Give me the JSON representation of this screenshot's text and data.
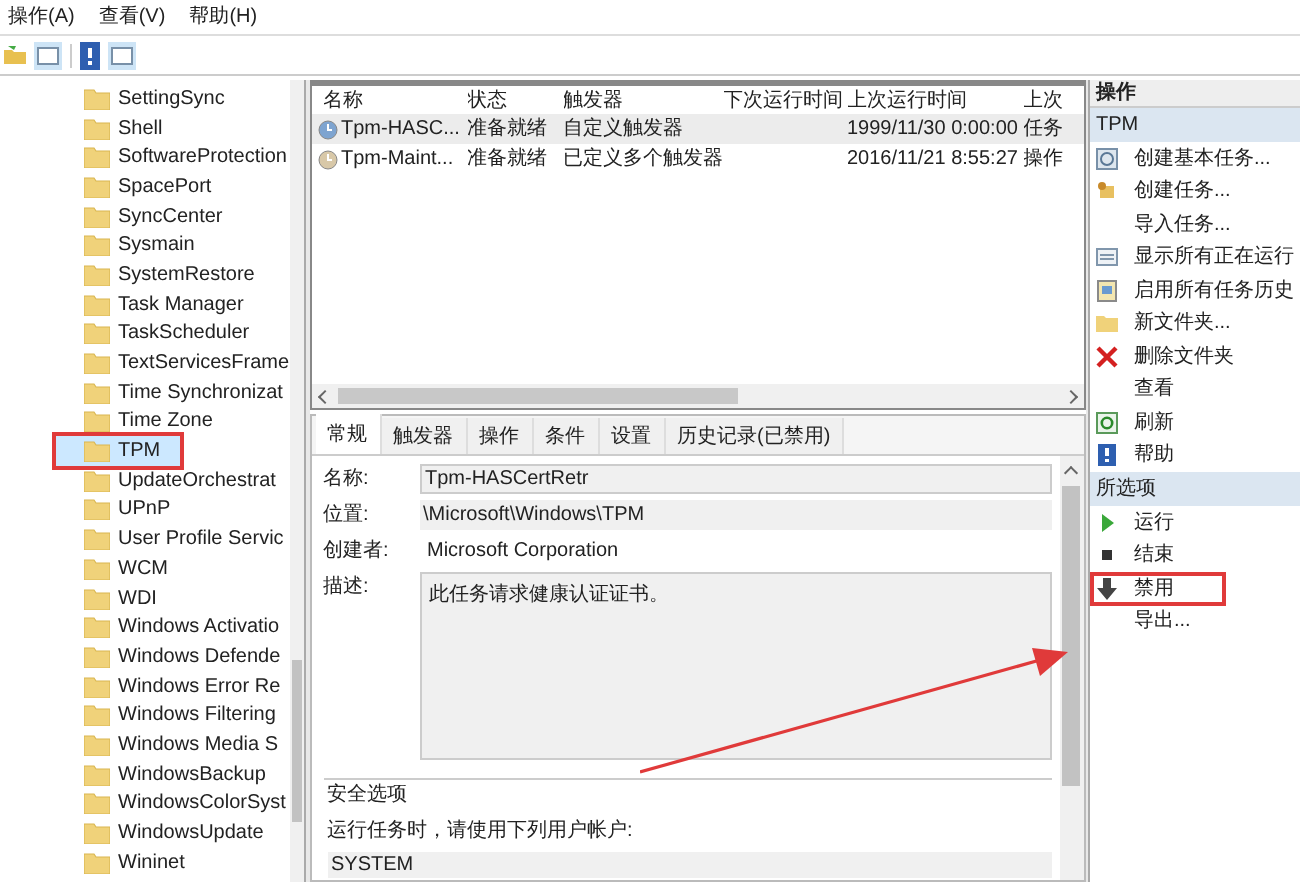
{
  "menu": [
    "操作(A)",
    "查看(V)",
    "帮助(H)"
  ],
  "tree": [
    {
      "label": "SettingSync",
      "selected": false,
      "highlighted": false
    },
    {
      "label": "Shell",
      "selected": false,
      "highlighted": false
    },
    {
      "label": "SoftwareProtection",
      "selected": false,
      "highlighted": false
    },
    {
      "label": "SpacePort",
      "selected": false,
      "highlighted": false
    },
    {
      "label": "SyncCenter",
      "selected": false,
      "highlighted": false
    },
    {
      "label": "Sysmain",
      "selected": false,
      "highlighted": false
    },
    {
      "label": "SystemRestore",
      "selected": false,
      "highlighted": false
    },
    {
      "label": "Task Manager",
      "selected": false,
      "highlighted": false
    },
    {
      "label": "TaskScheduler",
      "selected": false,
      "highlighted": false
    },
    {
      "label": "TextServicesFrame",
      "selected": false,
      "highlighted": false
    },
    {
      "label": "Time Synchronizat",
      "selected": false,
      "highlighted": false
    },
    {
      "label": "Time Zone",
      "selected": false,
      "highlighted": false
    },
    {
      "label": "TPM",
      "selected": true,
      "highlighted": true
    },
    {
      "label": "UpdateOrchestrat",
      "selected": false,
      "highlighted": false
    },
    {
      "label": "UPnP",
      "selected": false,
      "highlighted": false
    },
    {
      "label": "User Profile Servic",
      "selected": false,
      "highlighted": false
    },
    {
      "label": "WCM",
      "selected": false,
      "highlighted": false
    },
    {
      "label": "WDI",
      "selected": false,
      "highlighted": false
    },
    {
      "label": "Windows Activatio",
      "selected": false,
      "highlighted": false
    },
    {
      "label": "Windows Defende",
      "selected": false,
      "highlighted": false
    },
    {
      "label": "Windows Error Re",
      "selected": false,
      "highlighted": false
    },
    {
      "label": "Windows Filtering",
      "selected": false,
      "highlighted": false
    },
    {
      "label": "Windows Media S",
      "selected": false,
      "highlighted": false
    },
    {
      "label": "WindowsBackup",
      "selected": false,
      "highlighted": false
    },
    {
      "label": "WindowsColorSyst",
      "selected": false,
      "highlighted": false
    },
    {
      "label": "WindowsUpdate",
      "selected": false,
      "highlighted": false
    },
    {
      "label": "Wininet",
      "selected": false,
      "highlighted": false
    }
  ],
  "tasks": {
    "columns": [
      "名称",
      "状态",
      "触发器",
      "下次运行时间",
      "上次运行时间",
      "上次"
    ],
    "rows": [
      {
        "selected": true,
        "cells": [
          "Tpm-HASC...",
          "准备就绪",
          "自定义触发器",
          "",
          "1999/11/30 0:00:00",
          "任务"
        ]
      },
      {
        "selected": false,
        "cells": [
          "Tpm-Maint...",
          "准备就绪",
          "已定义多个触发器",
          "",
          "2016/11/21 8:55:27",
          "操作"
        ]
      }
    ]
  },
  "detail_tabs": [
    {
      "label": "常规",
      "selected": true
    },
    {
      "label": "触发器",
      "selected": false
    },
    {
      "label": "操作",
      "selected": false
    },
    {
      "label": "条件",
      "selected": false
    },
    {
      "label": "设置",
      "selected": false
    },
    {
      "label": "历史记录(已禁用)",
      "selected": false
    }
  ],
  "general": {
    "name_label": "名称:",
    "name": "Tpm-HASCertRetr",
    "location_label": "位置:",
    "location": "\\Microsoft\\Windows\\TPM",
    "author_label": "创建者:",
    "author": "Microsoft Corporation",
    "description_label": "描述:",
    "description": "此任务请求健康认证证书。",
    "security_title": "安全选项",
    "run_as_label": "运行任务时，请使用下列用户帐户:",
    "run_as": "SYSTEM"
  },
  "actions": {
    "title": "操作",
    "sections": [
      {
        "title": "TPM",
        "items": [
          {
            "label": "创建基本任务...",
            "kind": "wizard",
            "highlighted": false
          },
          {
            "label": "创建任务...",
            "kind": "task",
            "highlighted": false
          },
          {
            "label": "导入任务...",
            "kind": "none",
            "highlighted": false
          },
          {
            "label": "显示所有正在运行",
            "kind": "list",
            "highlighted": false
          },
          {
            "label": "启用所有任务历史",
            "kind": "history",
            "highlighted": false
          },
          {
            "label": "新文件夹...",
            "kind": "folder",
            "highlighted": false
          },
          {
            "label": "删除文件夹",
            "kind": "delete",
            "highlighted": false
          },
          {
            "label": "查看",
            "kind": "none",
            "highlighted": false
          },
          {
            "label": "刷新",
            "kind": "refresh",
            "highlighted": false
          },
          {
            "label": "帮助",
            "kind": "help",
            "highlighted": false
          }
        ]
      },
      {
        "title": "所选项",
        "items": [
          {
            "label": "运行",
            "kind": "run",
            "highlighted": false
          },
          {
            "label": "结束",
            "kind": "stop",
            "highlighted": false
          },
          {
            "label": "禁用",
            "kind": "disable",
            "highlighted": true
          },
          {
            "label": "导出...",
            "kind": "none",
            "highlighted": false
          }
        ]
      }
    ]
  }
}
